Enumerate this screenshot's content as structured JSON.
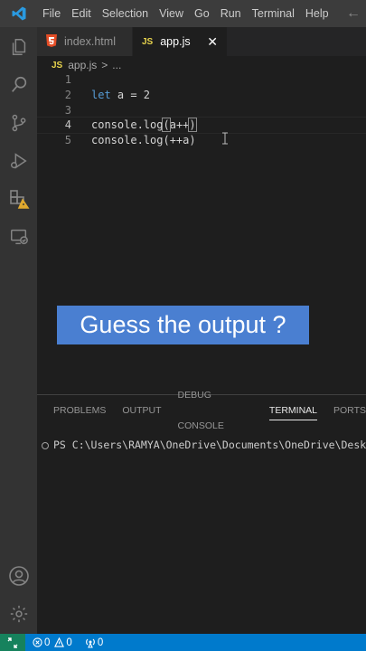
{
  "titlebar": {
    "menu": [
      "File",
      "Edit",
      "Selection",
      "View",
      "Go",
      "Run",
      "Terminal",
      "Help"
    ],
    "back_icon": "arrow-left-icon"
  },
  "activity_bar": {
    "items": [
      "explorer-icon",
      "search-icon",
      "source-control-icon",
      "run-debug-icon",
      "extensions-warning-icon",
      "remote-explorer-icon"
    ],
    "bottom": [
      "account-icon",
      "settings-gear-icon"
    ]
  },
  "tabs": [
    {
      "label": "index.html",
      "icon": "html5-icon",
      "active": false
    },
    {
      "label": "app.js",
      "icon": "JS",
      "active": true
    }
  ],
  "breadcrumb": {
    "icon": "JS",
    "file": "app.js",
    "sep": ">",
    "more": "..."
  },
  "editor": {
    "line_numbers": [
      "1",
      "2",
      "3",
      "4",
      "5"
    ],
    "lines": {
      "l2_kw": "let",
      "l2_rest": " a = 2",
      "l4_pre": "console.log",
      "l4_open": "(",
      "l4_arg": "a++",
      "l4_close": ")",
      "l5": "console.log(++a)"
    }
  },
  "overlay": {
    "text": "Guess the output ?"
  },
  "panel": {
    "tabs": [
      "PROBLEMS",
      "OUTPUT",
      "DEBUG CONSOLE",
      "TERMINAL",
      "PORTS"
    ],
    "active_tab": "TERMINAL",
    "terminal_line": "PS C:\\Users\\RAMYA\\OneDrive\\Documents\\OneDrive\\Desktop\\"
  },
  "statusbar": {
    "errors": "0",
    "warnings": "0",
    "ports": "0"
  },
  "colors": {
    "accent": "#007acc",
    "overlay_bg": "#4a7fd1",
    "keyword": "#569cd6"
  }
}
